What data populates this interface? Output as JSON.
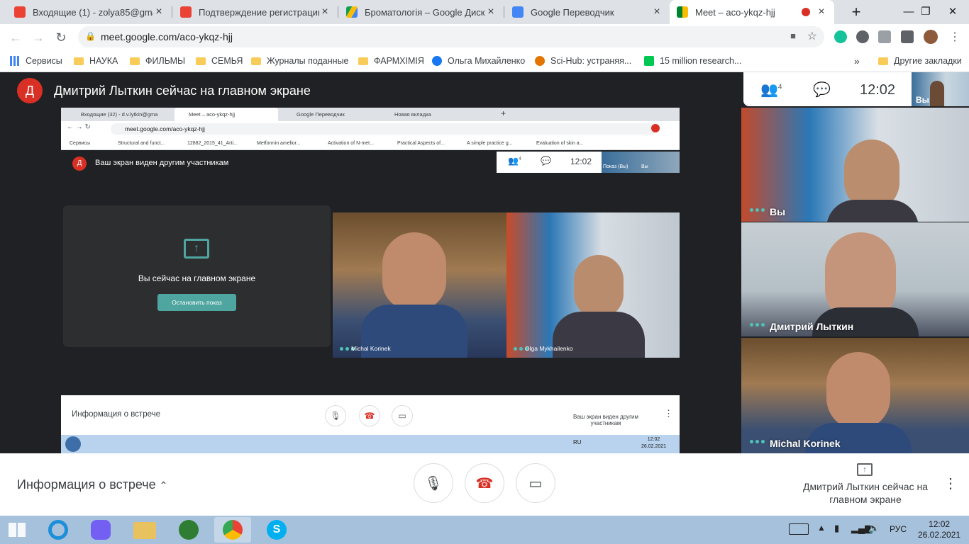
{
  "browser": {
    "tabs": [
      {
        "title": "Входящие (1) - zolya85@gmail.c",
        "favicon": "gmail-icon"
      },
      {
        "title": "Подтверждение регистрации -",
        "favicon": "gmail-icon"
      },
      {
        "title": "Броматологія – Google Диск",
        "favicon": "drive-icon"
      },
      {
        "title": "Google Переводчик",
        "favicon": "translate-icon"
      },
      {
        "title": "Meet – aco-ykqz-hjj",
        "favicon": "meet-icon",
        "active": true
      }
    ],
    "url": "meet.google.com/aco-ykqz-hjj",
    "bookmarks": [
      "Сервисы",
      "НАУКА",
      "ФИЛЬМЫ",
      "СЕМЬЯ",
      "Журналы поданные",
      "ФАРМХІМІЯ",
      "Ольга Михайленко",
      "Sci-Hub: устраняя...",
      "15 million research..."
    ],
    "other_bookmarks": "Другие закладки"
  },
  "meet": {
    "presenter_initial": "Д",
    "presenter_text": "Дмитрий Лыткин сейчас на главном экране",
    "participant_count": "4",
    "clock": "12:02",
    "self_label": "Вы",
    "tiles": [
      {
        "name": "Вы"
      },
      {
        "name": "Дмитрий Лыткин"
      },
      {
        "name": "Michal Korinek"
      }
    ],
    "bottom": {
      "info": "Информация о встрече",
      "present_status": "Дмитрий Лыткин сейчас на главном экране"
    }
  },
  "shared_screen": {
    "tabs": [
      "Входящие (32) - d.v.lytkin@gma",
      "Meet – aco-ykqz-hjj",
      "Google Переводчик",
      "Новая вкладка"
    ],
    "url": "meet.google.com/aco-ykqz-hjj",
    "bookmarks": [
      "Сервисы",
      "Structural and funct...",
      "12882_2015_41_Arti...",
      "Metformin amelior...",
      "Activation of N-met...",
      "Practical Aspects of...",
      "A simple practice g...",
      "Evaluation of skin a..."
    ],
    "presenter_initial": "Д",
    "presenter_text": "Ваш экран виден другим участникам",
    "participant_count": "4",
    "clock": "12:02",
    "self_label": "Показ (Вы)",
    "self_label2": "Вы",
    "present_card_text": "Вы сейчас на главном экране",
    "stop_button": "Остановить показ",
    "videos": [
      {
        "name": "Michal Korinek"
      },
      {
        "name": "Olga Mykhailenko"
      }
    ],
    "bottom_info": "Информация о встрече",
    "bottom_status": "Ваш экран виден другим участникам",
    "taskbar_lang": "RU",
    "taskbar_time": "12:02",
    "taskbar_date": "26.02.2021"
  },
  "os": {
    "lang": "РУС",
    "time": "12:02",
    "date": "26.02.2021"
  }
}
